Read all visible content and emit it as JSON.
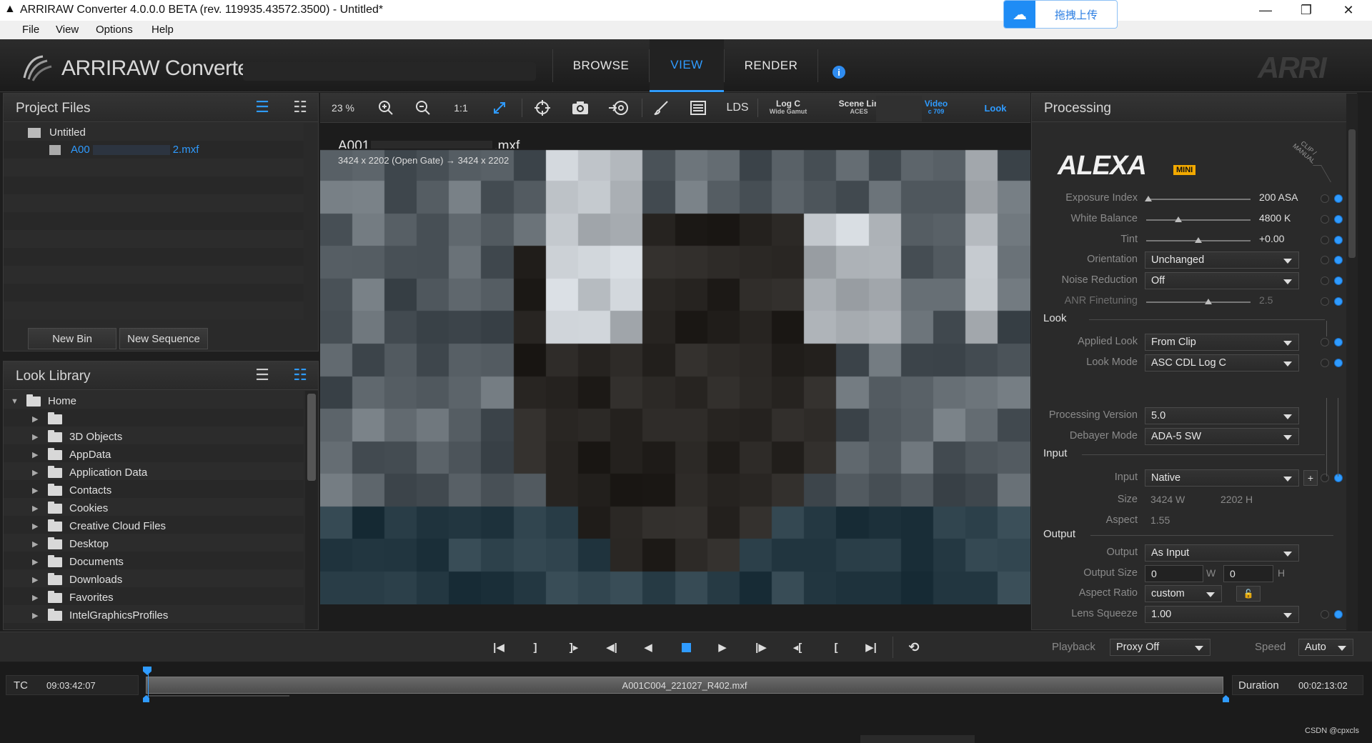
{
  "window": {
    "title": "ARRIRAW Converter 4.0.0.0 BETA (rev. 119935.43572.3500) - Untitled*",
    "minimize": "—",
    "restore": "❐",
    "close": "✕"
  },
  "baidu": {
    "label": "拖拽上传",
    "icon": "cloud-icon"
  },
  "menu": [
    "File",
    "View",
    "Options",
    "Help"
  ],
  "header": {
    "app_name": "ARRIRAW Converter",
    "tabs": [
      "BROWSE",
      "VIEW",
      "RENDER"
    ],
    "active_tab": "VIEW",
    "brand": "ARRI",
    "info": "i"
  },
  "project_files": {
    "title": "Project Files",
    "items": [
      "Untitled",
      "A00",
      "2.mxf"
    ],
    "buttons": [
      "New Bin",
      "New Sequence"
    ]
  },
  "look_library": {
    "title": "Look Library",
    "home": "Home",
    "folders": [
      "",
      "3D Objects",
      "AppData",
      "Application Data",
      "Contacts",
      "Cookies",
      "Creative Cloud Files",
      "Desktop",
      "Documents",
      "Downloads",
      "Favorites",
      "IntelGraphicsProfiles"
    ]
  },
  "viewer": {
    "zoom": "23 %",
    "one_to_one": "1:1",
    "lds": "LDS",
    "logc": "Log C",
    "logc_sub": "Wide Gamut",
    "scene": "Scene Lin",
    "scene_sub": "ACES",
    "video": "Video",
    "video_sub": "c 709",
    "look": "Look",
    "filename_a": "A001",
    "filename_b": ".mxf",
    "resolution": "3424 x 2202 (Open Gate) → 3424 x 2202"
  },
  "processing": {
    "title": "Processing",
    "camera": "ALEXA",
    "camera_badge": "MINI",
    "clip_manual": "CLIP / MANUAL",
    "exposure": {
      "label": "Exposure Index",
      "value": "200 ASA",
      "level": 0
    },
    "white_balance": {
      "label": "White Balance",
      "value": "4800 K",
      "level": 0.3
    },
    "tint": {
      "label": "Tint",
      "value": "+0.00",
      "level": 0.5
    },
    "orientation": {
      "label": "Orientation",
      "value": "Unchanged"
    },
    "noise": {
      "label": "Noise Reduction",
      "value": "Off"
    },
    "anr": {
      "label": "ANR Finetuning",
      "value": "2.5",
      "level": 0.6
    },
    "look_section": "Look",
    "applied_look": {
      "label": "Applied Look",
      "value": "From Clip"
    },
    "look_mode": {
      "label": "Look Mode",
      "value": "ASC CDL Log C"
    },
    "proc_version": {
      "label": "Processing Version",
      "value": "5.0"
    },
    "debayer": {
      "label": "Debayer Mode",
      "value": "ADA-5 SW"
    },
    "input_section": "Input",
    "input": {
      "label": "Input",
      "value": "Native"
    },
    "size": {
      "label": "Size",
      "w": "3424 W",
      "h": "2202 H"
    },
    "aspect": {
      "label": "Aspect",
      "value": "1.55"
    },
    "output_section": "Output",
    "output": {
      "label": "Output",
      "value": "As Input"
    },
    "output_size": {
      "label": "Output Size",
      "w": "0",
      "w_unit": "W",
      "h": "0",
      "h_unit": "H"
    },
    "aspect_ratio": {
      "label": "Aspect Ratio",
      "value": "custom"
    },
    "lens": {
      "label": "Lens Squeeze",
      "value": "1.00"
    },
    "plus": "+"
  },
  "transport": {
    "playback_label": "Playback",
    "playback_value": "Proxy Off",
    "speed_label": "Speed",
    "speed_value": "Auto"
  },
  "timeline": {
    "tc_label": "TC",
    "tc_value": "09:03:42:07",
    "clip": "A001C004_221027_R402.mxf",
    "duration_label": "Duration",
    "duration_value": "00:02:13:02",
    "watermark": "CSDN @cpxcls"
  }
}
